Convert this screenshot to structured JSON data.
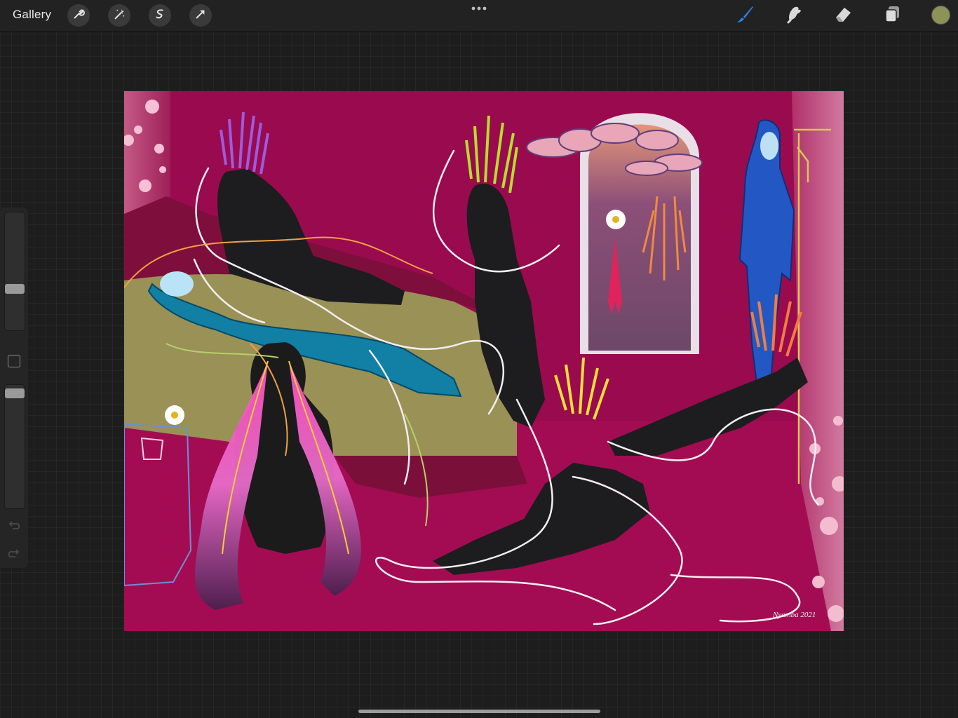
{
  "toolbar": {
    "gallery_label": "Gallery",
    "left_tools": [
      "wrench-icon",
      "magic-wand-icon",
      "selection-icon",
      "transform-icon"
    ],
    "more_icon": "more-dots-icon",
    "right_tools": [
      "brush-icon",
      "smudge-icon",
      "eraser-icon",
      "layers-icon"
    ],
    "active_tool": "brush",
    "current_color": "#8f9258"
  },
  "sidebar": {
    "brush_size": 0.34,
    "opacity": 0.97,
    "modify_button": "square-icon",
    "undo": "undo-icon",
    "redo": "redo-icon"
  },
  "canvas": {
    "background_color": "#9a0a4e",
    "signature": "Nyamba 2021"
  }
}
